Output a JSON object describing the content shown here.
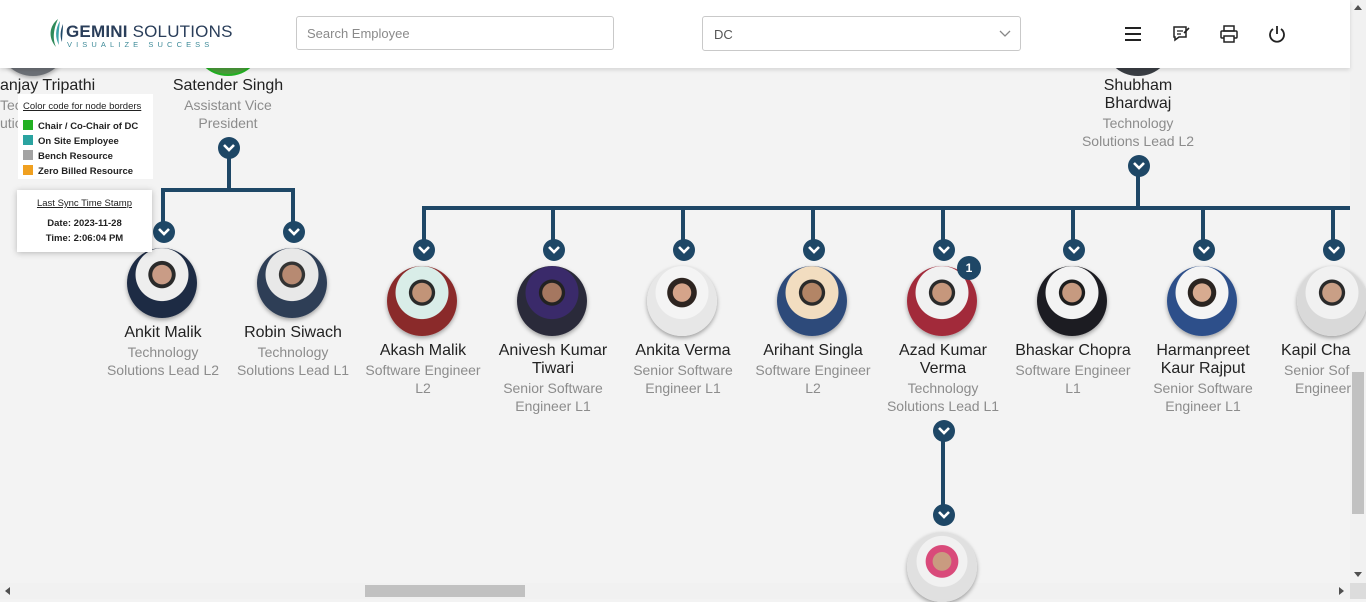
{
  "header": {
    "logo_name_bold": "GEMINI",
    "logo_name_rest": " SOLUTIONS",
    "logo_tagline": "VISUALIZE SUCCESS",
    "search_placeholder": "Search Employee",
    "dc_select_value": "DC",
    "icons": [
      "menu-icon",
      "feedback-icon",
      "print-icon",
      "power-icon"
    ]
  },
  "legend": {
    "title": "Color code for node borders",
    "items": [
      {
        "label": "Chair / Co-Chair of DC",
        "color": "#22b022"
      },
      {
        "label": "On Site Employee",
        "color": "#2aa3a0"
      },
      {
        "label": "Bench Resource",
        "color": "#a3a3a3"
      },
      {
        "label": "Zero Billed Resource",
        "color": "#f0a020"
      }
    ]
  },
  "sync": {
    "title": "Last Sync Time Stamp",
    "date": "Date: 2023-11-28",
    "time": "Time: 2:06:04 PM"
  },
  "colors": {
    "connector": "#1e4766",
    "accent": "#1e4766"
  },
  "nodes": {
    "partial_left": {
      "name": "anjay Tripathi",
      "designation_l1": "Tec",
      "designation_l2": "utio"
    },
    "satender": {
      "name": "Satender Singh",
      "designation_l1": "Assistant Vice",
      "designation_l2": "President"
    },
    "shubham": {
      "name_l1": "Shubham",
      "name_l2": "Bhardwaj",
      "designation_l1": "Technology",
      "designation_l2": "Solutions Lead L2"
    },
    "ankit_malik": {
      "name": "Ankit Malik",
      "designation_l1": "Technology",
      "designation_l2": "Solutions Lead L2"
    },
    "robin": {
      "name": "Robin Siwach",
      "designation_l1": "Technology",
      "designation_l2": "Solutions Lead L1"
    },
    "akash": {
      "name": "Akash Malik",
      "designation_l1": "Software Engineer",
      "designation_l2": "L2"
    },
    "anivesh": {
      "name_l1": "Anivesh Kumar",
      "name_l2": "Tiwari",
      "designation_l1": "Senior Software",
      "designation_l2": "Engineer L1"
    },
    "ankita": {
      "name": "Ankita Verma",
      "designation_l1": "Senior Software",
      "designation_l2": "Engineer L1"
    },
    "arihant": {
      "name": "Arihant Singla",
      "designation_l1": "Software Engineer",
      "designation_l2": "L2"
    },
    "azad": {
      "name_l1": "Azad Kumar",
      "name_l2": "Verma",
      "designation_l1": "Technology",
      "designation_l2": "Solutions Lead L1",
      "badge": "1"
    },
    "bhaskar": {
      "name": "Bhaskar Chopra",
      "designation_l1": "Software Engineer",
      "designation_l2": "L1"
    },
    "harmanpreet": {
      "name_l1": "Harmanpreet",
      "name_l2": "Kaur Rajput",
      "designation_l1": "Senior Software",
      "designation_l2": "Engineer L1"
    },
    "kapil": {
      "name": "Kapil Cha",
      "designation_l1": "Senior Sof",
      "designation_l2": "Engineer"
    }
  }
}
